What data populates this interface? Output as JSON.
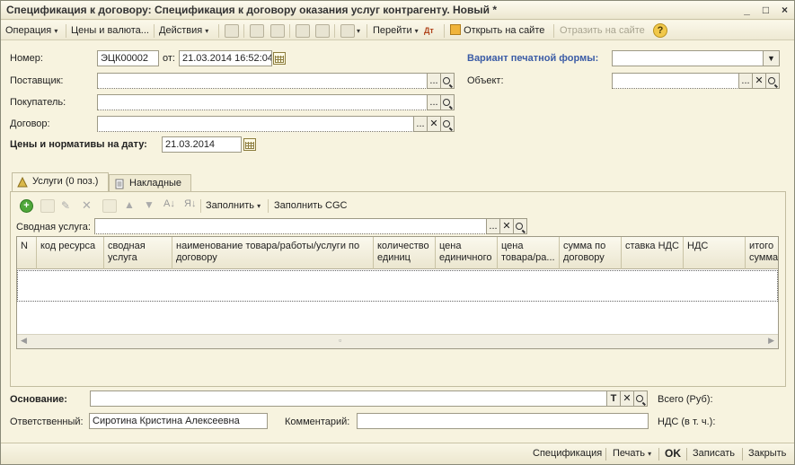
{
  "window": {
    "title": "Спецификация к договору: Спецификация к договору оказания услуг контрагенту. Новый *",
    "btn_minimize": "_",
    "btn_maximize": "□",
    "btn_close": "×"
  },
  "toolbar": {
    "operation": "Операция",
    "prices": "Цены и валюта...",
    "actions": "Действия",
    "goto": "Перейти",
    "open_on_site": "Открыть на сайте",
    "reflect_on_site": "Отразить на сайте",
    "help": "?"
  },
  "form": {
    "number_label": "Номер:",
    "number_value": "ЭЦК00002",
    "from_label": "от:",
    "date_value": "21.03.2014 16:52:04",
    "supplier_label": "Поставщик:",
    "supplier_value": "",
    "buyer_label": "Покупатель:",
    "buyer_value": "",
    "contract_label": "Договор:",
    "contract_value": "",
    "prices_date_label": "Цены и нормативы на дату:",
    "prices_date_value": "21.03.2014",
    "print_variant_label": "Вариант печатной формы:",
    "print_variant_value": "",
    "object_label": "Объект:",
    "object_value": ""
  },
  "tabs": [
    {
      "label": "Услуги (0 поз.)",
      "active": true
    },
    {
      "label": "Накладные",
      "active": false
    }
  ],
  "services_toolbar": {
    "fill": "Заполнить",
    "fill_cgc": "Заполнить CGC",
    "summary_label": "Сводная услуга:",
    "summary_value": ""
  },
  "table": {
    "columns": [
      "N",
      "код ресурса",
      "сводная услуга",
      "наименование товара/работы/услуги по договору",
      "количество единиц",
      "цена единичного",
      "цена товара/ра...",
      "сумма по договору",
      "ставка НДС",
      "НДС",
      "итого сумма"
    ],
    "rows": []
  },
  "bottom": {
    "basis_label": "Основание:",
    "basis_value": "",
    "basis_t": "T",
    "responsible_label": "Ответственный:",
    "responsible_value": "Сиротина Кристина Алексеевна",
    "comment_label": "Комментарий:",
    "comment_value": "",
    "total_label": "Всего (Руб):",
    "vat_label": "НДС (в т. ч.):"
  },
  "footer": {
    "spec": "Спецификация",
    "print": "Печать",
    "ok": "OK",
    "save": "Записать",
    "close": "Закрыть"
  },
  "colors": {
    "background": "#f7f3df",
    "accent_label": "#3b5ca6"
  }
}
